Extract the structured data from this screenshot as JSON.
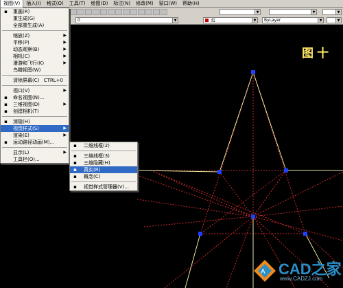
{
  "menubar": {
    "items": [
      "视图(V)",
      "插入(I)",
      "格式(O)",
      "工具(T)",
      "绘图(D)",
      "标注(N)",
      "修改(M)",
      "窗口(W)",
      "帮助(H)"
    ]
  },
  "toolbar": {
    "layer_value": "0",
    "color_value": "红",
    "linetype_value": "ByLayer"
  },
  "view_menu": {
    "items": [
      {
        "label": "重画(R)",
        "icon": "redraw-icon"
      },
      {
        "label": "重生成(G)"
      },
      {
        "label": "全部重生成(A)"
      },
      {
        "sep": true
      },
      {
        "label": "缩放(Z)",
        "sub": true
      },
      {
        "label": "平移(P)",
        "sub": true
      },
      {
        "label": "动态观察(B)",
        "sub": true
      },
      {
        "label": "相机(C)",
        "sub": true
      },
      {
        "label": "漫游和飞行(K)",
        "sub": true
      },
      {
        "label": "鸟瞰视图(W)"
      },
      {
        "sep": true
      },
      {
        "label": "清除屏幕(C)",
        "accel": "CTRL+0"
      },
      {
        "sep": true
      },
      {
        "label": "视口(V)",
        "sub": true
      },
      {
        "label": "命名视图(N)...",
        "icon": "named-view-icon"
      },
      {
        "label": "三维视图(D)",
        "sub": true,
        "icon": "3d-view-icon"
      },
      {
        "label": "创建相机(T)",
        "icon": "camera-icon"
      },
      {
        "sep": true
      },
      {
        "label": "消隐(H)",
        "icon": "hide-icon"
      },
      {
        "label": "视觉样式(S)",
        "sub": true,
        "highlight": true
      },
      {
        "label": "渲染(E)",
        "sub": true
      },
      {
        "label": "运动路径动画(M)...",
        "icon": "motion-path-icon"
      },
      {
        "sep": true
      },
      {
        "label": "显示(L)",
        "sub": true
      },
      {
        "label": "工具栏(O)..."
      }
    ]
  },
  "visual_styles_menu": {
    "items": [
      {
        "label": "二维线框(2)",
        "icon": "2d-wireframe-icon"
      },
      {
        "sep": true
      },
      {
        "label": "三维线框(3)",
        "icon": "3d-wireframe-icon"
      },
      {
        "label": "三维隐藏(H)",
        "icon": "3d-hidden-icon"
      },
      {
        "label": "真实(R)",
        "icon": "realistic-icon",
        "highlight": true
      },
      {
        "label": "概念(C)",
        "icon": "conceptual-icon"
      },
      {
        "sep": true
      },
      {
        "label": "视觉样式管理器(V)...",
        "icon": "style-manager-icon"
      }
    ]
  },
  "drawing": {
    "banner": "图十",
    "watermark_brand": "CAD之家",
    "watermark_url": "www.CADZJ.com",
    "colors": {
      "construction": "#cc2a2a",
      "edge": "#e8e8a0",
      "grip": "#2040ff"
    }
  }
}
